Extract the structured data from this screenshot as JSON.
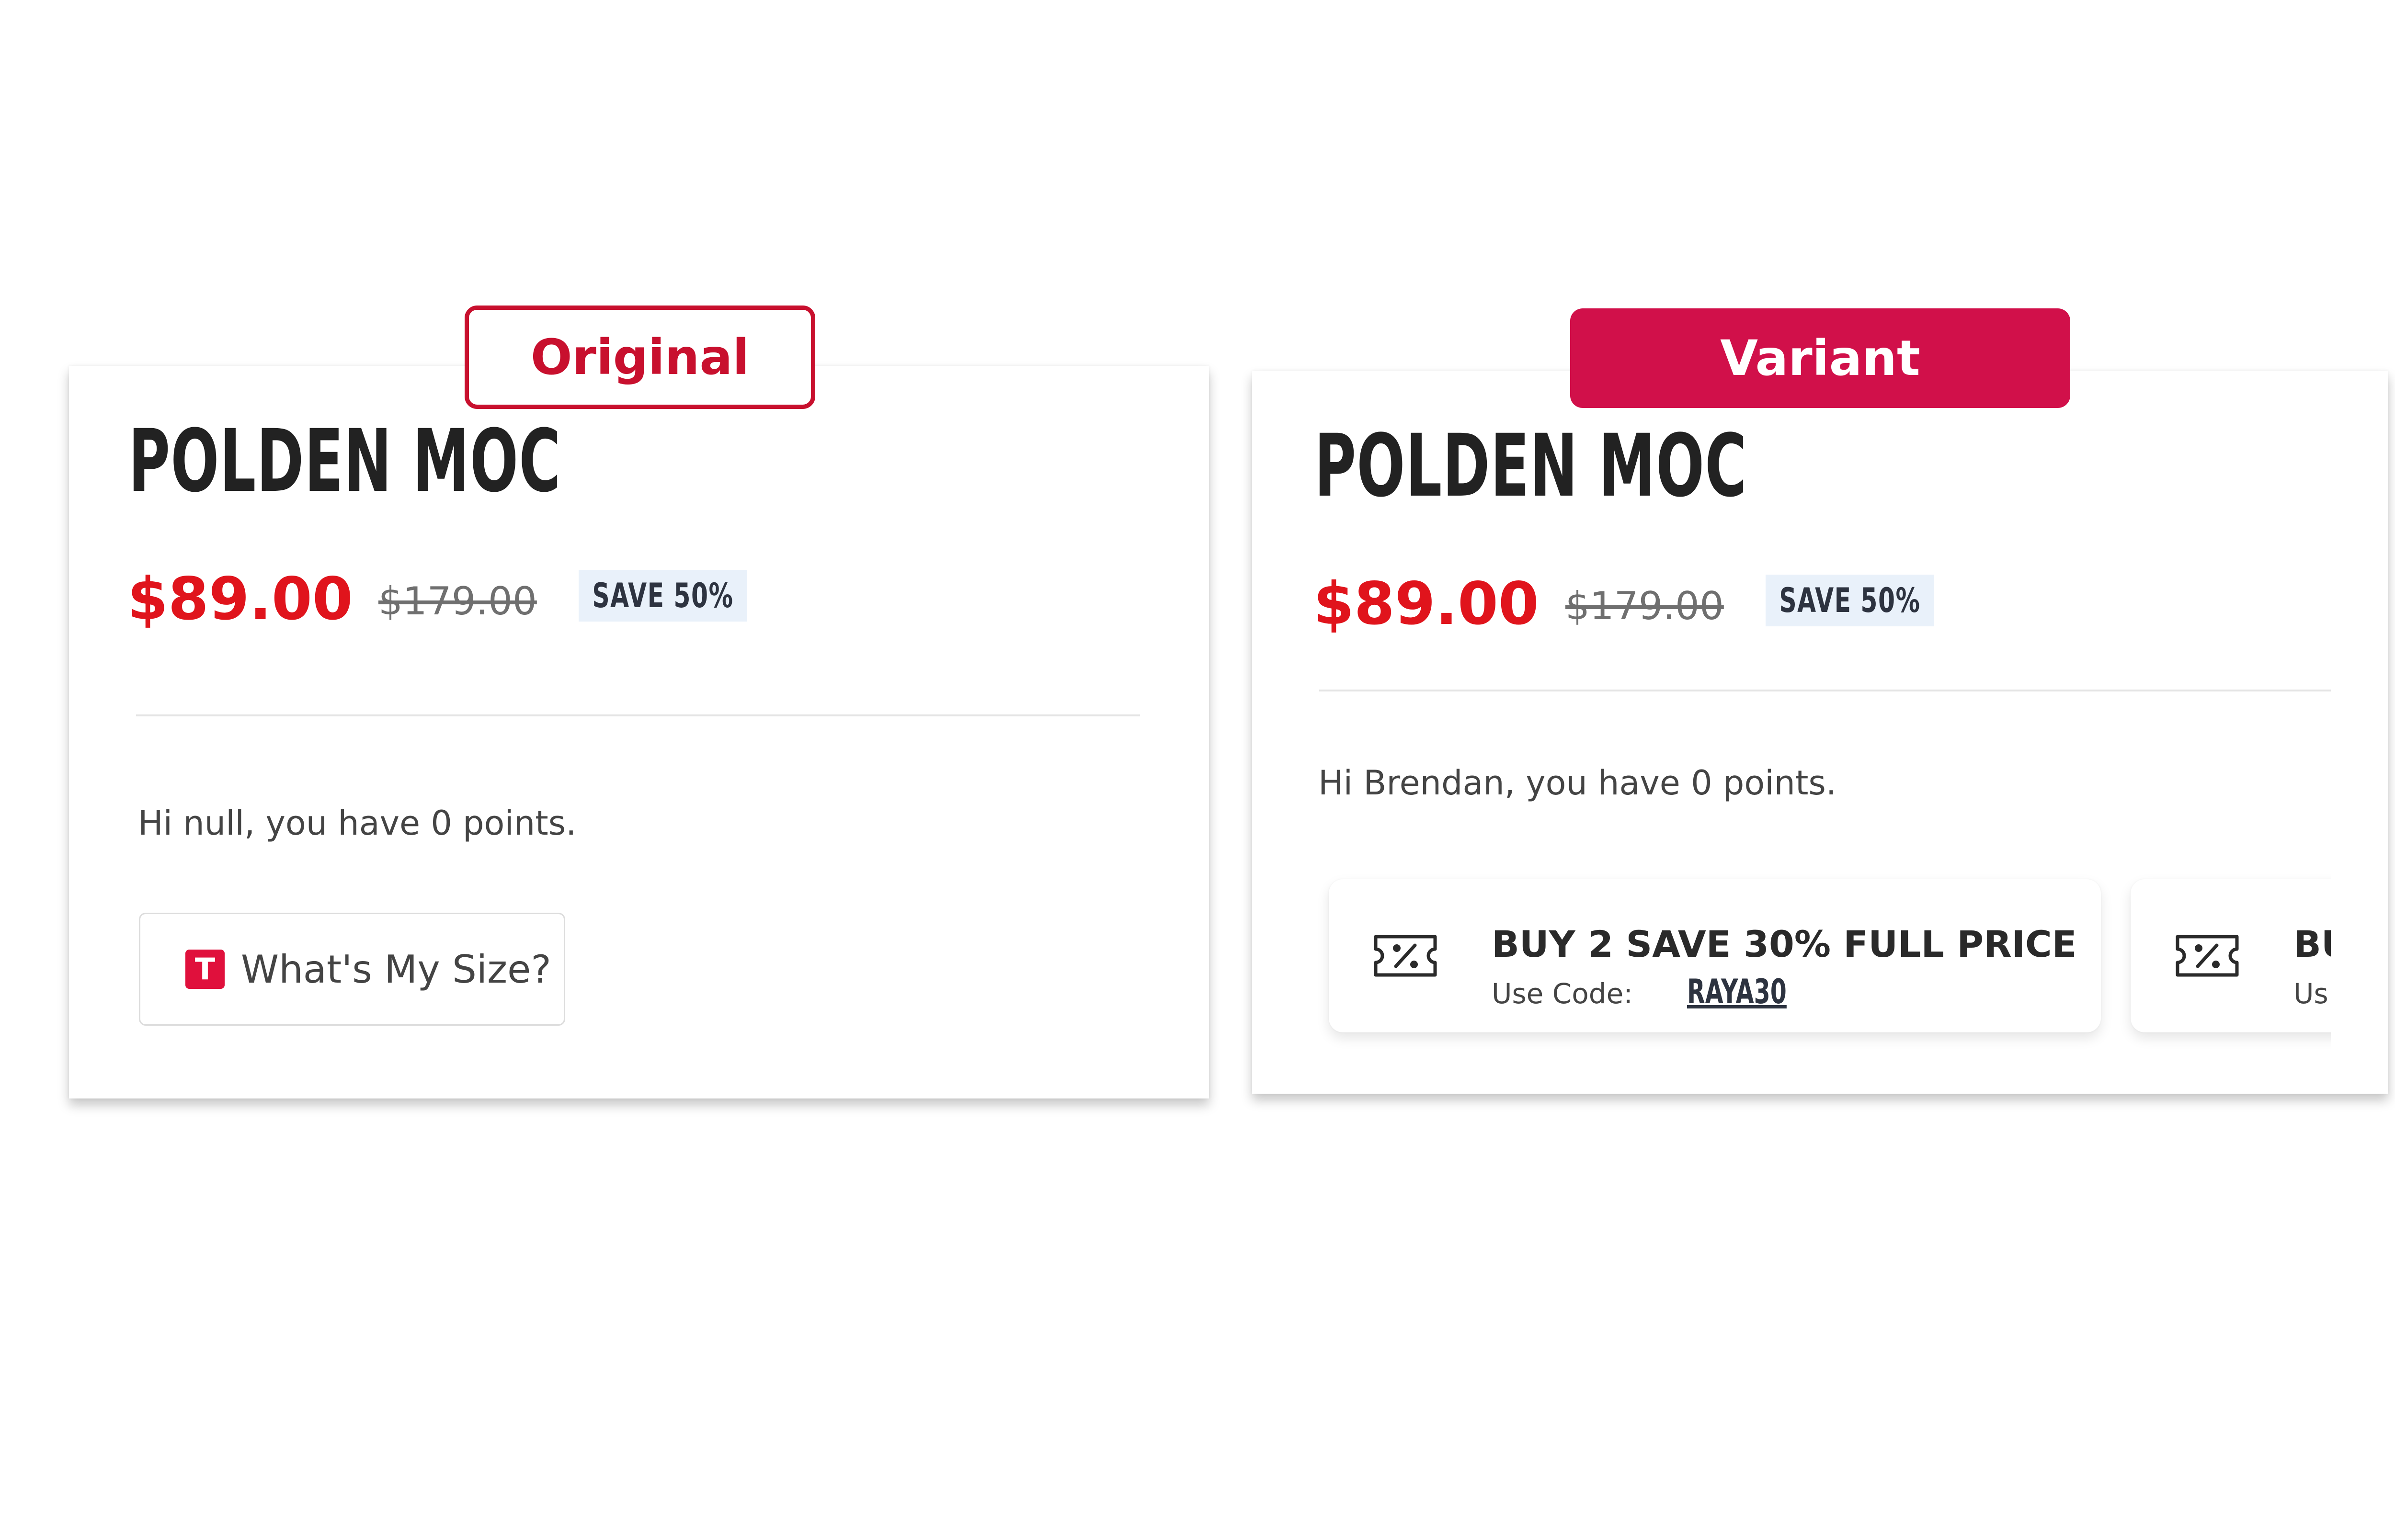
{
  "tags": {
    "original": "Original",
    "variant": "Variant"
  },
  "colors": {
    "price_red": "#e0141c",
    "tag_red": "#c8102e",
    "variant_tag_bg": "#d1104a",
    "badge_bg": "#e9f1fa",
    "size_logo_red": "#e0103c"
  },
  "original": {
    "product_title": "POLDEN MOC",
    "price": "$89.00",
    "old_price": "$179.00",
    "save_badge": "SAVE 50%",
    "greeting": "Hi null, you have 0 points.",
    "size_button": {
      "icon": "size-brand-logo-icon",
      "logo_letter": "T",
      "label": "What's My Size?"
    }
  },
  "variant": {
    "product_title": "POLDEN MOC",
    "price": "$89.00",
    "old_price": "$179.00",
    "save_badge": "SAVE 50%",
    "greeting": "Hi Brendan, you have 0 points.",
    "promos": [
      {
        "icon": "coupon-percent-icon",
        "title": "BUY 2 SAVE 30% FULL PRICE",
        "code_label": "Use Code:",
        "code": "RAYA30"
      },
      {
        "icon": "coupon-percent-icon",
        "title": "BU",
        "code_label": "Us"
      }
    ]
  }
}
